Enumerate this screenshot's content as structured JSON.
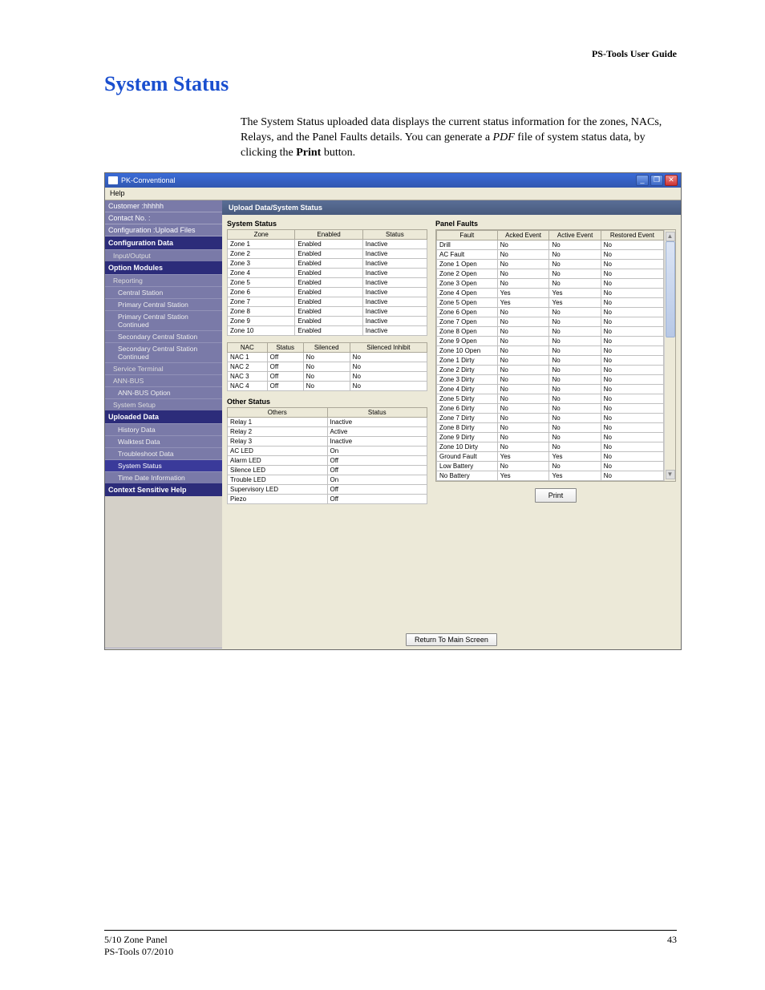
{
  "doc": {
    "header_right": "PS-Tools User Guide",
    "section_title": "System Status",
    "intro_part1": "The System Status uploaded data displays the current status information for the zones, NACs, Relays, and the Panel Faults details. You can generate a ",
    "intro_pdf": "PDF",
    "intro_part2": " file of system status data, by clicking the ",
    "intro_print": "Print",
    "intro_part3": " button.",
    "footer_left1": "5/10 Zone Panel",
    "footer_left2": "PS-Tools 07/2010",
    "footer_page": "43"
  },
  "win": {
    "title": "PK-Conventional",
    "menu_help": "Help",
    "minimize": "_",
    "maximize": "❐",
    "close": "✕"
  },
  "sidebar": {
    "customer_lbl": "Customer :hhhhh",
    "contact_lbl": "Contact No. :",
    "config_upload": "Configuration :Upload Files",
    "hdr_config": "Configuration Data",
    "nav1": "Input/Output",
    "hdr_option": "Option Modules",
    "nav2": "Reporting",
    "nav3": "Central Station",
    "nav4": "Primary Central Station",
    "nav5": "Primary Central Station Continued",
    "nav6": "Secondary Central Station",
    "nav7": "Secondary Central Station Continued",
    "nav8": "Service Terminal",
    "nav9": "ANN-BUS",
    "nav10": "ANN-BUS Option",
    "nav11": "System Setup",
    "hdr_upload": "Uploaded Data",
    "nav12": "History Data",
    "nav13": "Walktest Data",
    "nav14": "Troubleshoot Data",
    "nav15": "System Status",
    "nav16": "Time Date Information",
    "hdr_context": "Context Sensitive Help"
  },
  "main": {
    "title": "Upload Data/System Status",
    "sys_status_hdr": "System Status",
    "other_status_hdr": "Other Status",
    "panel_faults_hdr": "Panel Faults",
    "print_btn": "Print",
    "return_btn": "Return To Main Screen",
    "zone_cols": {
      "c1": "Zone",
      "c2": "Enabled",
      "c3": "Status"
    },
    "zones": [
      {
        "z": "Zone 1",
        "en": "Enabled",
        "st": "Inactive"
      },
      {
        "z": "Zone 2",
        "en": "Enabled",
        "st": "Inactive"
      },
      {
        "z": "Zone 3",
        "en": "Enabled",
        "st": "Inactive"
      },
      {
        "z": "Zone 4",
        "en": "Enabled",
        "st": "Inactive"
      },
      {
        "z": "Zone 5",
        "en": "Enabled",
        "st": "Inactive"
      },
      {
        "z": "Zone 6",
        "en": "Enabled",
        "st": "Inactive"
      },
      {
        "z": "Zone 7",
        "en": "Enabled",
        "st": "Inactive"
      },
      {
        "z": "Zone 8",
        "en": "Enabled",
        "st": "Inactive"
      },
      {
        "z": "Zone 9",
        "en": "Enabled",
        "st": "Inactive"
      },
      {
        "z": "Zone 10",
        "en": "Enabled",
        "st": "Inactive"
      }
    ],
    "nac_cols": {
      "c1": "NAC",
      "c2": "Status",
      "c3": "Silenced",
      "c4": "Silenced Inhibit"
    },
    "nacs": [
      {
        "n": "NAC 1",
        "s": "Off",
        "si": "No",
        "sih": "No"
      },
      {
        "n": "NAC 2",
        "s": "Off",
        "si": "No",
        "sih": "No"
      },
      {
        "n": "NAC 3",
        "s": "Off",
        "si": "No",
        "sih": "No"
      },
      {
        "n": "NAC 4",
        "s": "Off",
        "si": "No",
        "sih": "No"
      }
    ],
    "other_cols": {
      "c1": "Others",
      "c2": "Status"
    },
    "others": [
      {
        "o": "Relay 1",
        "s": "Inactive"
      },
      {
        "o": "Relay 2",
        "s": "Active"
      },
      {
        "o": "Relay 3",
        "s": "Inactive"
      },
      {
        "o": "AC LED",
        "s": "On"
      },
      {
        "o": "Alarm LED",
        "s": "Off"
      },
      {
        "o": "Silence LED",
        "s": "Off"
      },
      {
        "o": "Trouble LED",
        "s": "On"
      },
      {
        "o": "Supervisory LED",
        "s": "Off"
      },
      {
        "o": "Piezo",
        "s": "Off"
      }
    ],
    "fault_cols": {
      "c1": "Fault",
      "c2": "Acked Event",
      "c3": "Active Event",
      "c4": "Restored Event"
    },
    "faults": [
      {
        "f": "Drill",
        "a": "No",
        "ac": "No",
        "r": "No"
      },
      {
        "f": "AC Fault",
        "a": "No",
        "ac": "No",
        "r": "No"
      },
      {
        "f": "Zone 1 Open",
        "a": "No",
        "ac": "No",
        "r": "No"
      },
      {
        "f": "Zone 2 Open",
        "a": "No",
        "ac": "No",
        "r": "No"
      },
      {
        "f": "Zone 3 Open",
        "a": "No",
        "ac": "No",
        "r": "No"
      },
      {
        "f": "Zone 4 Open",
        "a": "Yes",
        "ac": "Yes",
        "r": "No"
      },
      {
        "f": "Zone 5 Open",
        "a": "Yes",
        "ac": "Yes",
        "r": "No"
      },
      {
        "f": "Zone 6 Open",
        "a": "No",
        "ac": "No",
        "r": "No"
      },
      {
        "f": "Zone 7 Open",
        "a": "No",
        "ac": "No",
        "r": "No"
      },
      {
        "f": "Zone 8 Open",
        "a": "No",
        "ac": "No",
        "r": "No"
      },
      {
        "f": "Zone 9 Open",
        "a": "No",
        "ac": "No",
        "r": "No"
      },
      {
        "f": "Zone 10 Open",
        "a": "No",
        "ac": "No",
        "r": "No"
      },
      {
        "f": "Zone 1 Dirty",
        "a": "No",
        "ac": "No",
        "r": "No"
      },
      {
        "f": "Zone 2 Dirty",
        "a": "No",
        "ac": "No",
        "r": "No"
      },
      {
        "f": "Zone 3 Dirty",
        "a": "No",
        "ac": "No",
        "r": "No"
      },
      {
        "f": "Zone 4 Dirty",
        "a": "No",
        "ac": "No",
        "r": "No"
      },
      {
        "f": "Zone 5 Dirty",
        "a": "No",
        "ac": "No",
        "r": "No"
      },
      {
        "f": "Zone 6 Dirty",
        "a": "No",
        "ac": "No",
        "r": "No"
      },
      {
        "f": "Zone 7 Dirty",
        "a": "No",
        "ac": "No",
        "r": "No"
      },
      {
        "f": "Zone 8 Dirty",
        "a": "No",
        "ac": "No",
        "r": "No"
      },
      {
        "f": "Zone 9 Dirty",
        "a": "No",
        "ac": "No",
        "r": "No"
      },
      {
        "f": "Zone 10 Dirty",
        "a": "No",
        "ac": "No",
        "r": "No"
      },
      {
        "f": "Ground Fault",
        "a": "Yes",
        "ac": "Yes",
        "r": "No"
      },
      {
        "f": "Low Battery",
        "a": "No",
        "ac": "No",
        "r": "No"
      },
      {
        "f": "No Battery",
        "a": "Yes",
        "ac": "Yes",
        "r": "No"
      }
    ]
  }
}
